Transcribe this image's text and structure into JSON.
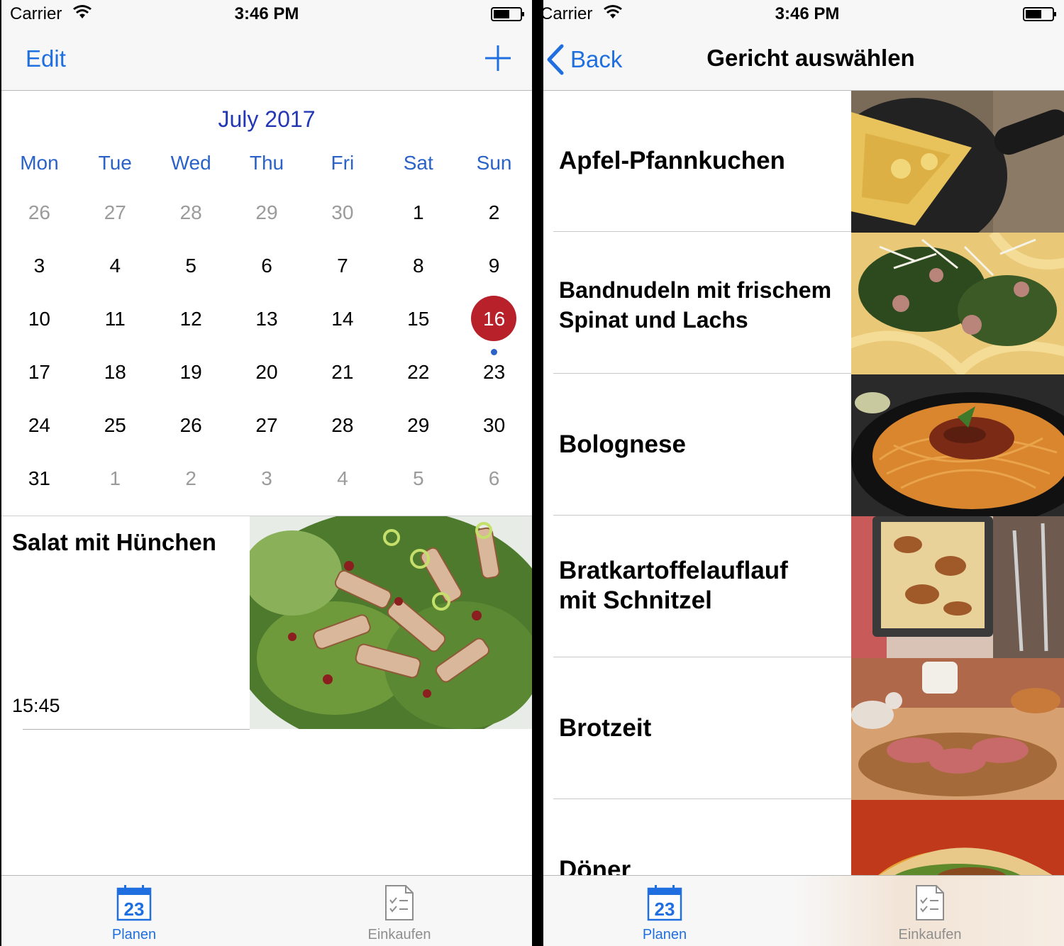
{
  "status_bar": {
    "carrier": "Carrier",
    "time": "3:46 PM"
  },
  "left": {
    "nav": {
      "edit_label": "Edit"
    },
    "calendar": {
      "month_title": "July 2017",
      "weekdays": [
        "Mon",
        "Tue",
        "Wed",
        "Thu",
        "Fri",
        "Sat",
        "Sun"
      ],
      "weeks": [
        [
          {
            "d": "26",
            "other": true
          },
          {
            "d": "27",
            "other": true
          },
          {
            "d": "28",
            "other": true
          },
          {
            "d": "29",
            "other": true
          },
          {
            "d": "30",
            "other": true
          },
          {
            "d": "1"
          },
          {
            "d": "2"
          }
        ],
        [
          {
            "d": "3"
          },
          {
            "d": "4"
          },
          {
            "d": "5"
          },
          {
            "d": "6"
          },
          {
            "d": "7"
          },
          {
            "d": "8"
          },
          {
            "d": "9"
          }
        ],
        [
          {
            "d": "10"
          },
          {
            "d": "11"
          },
          {
            "d": "12"
          },
          {
            "d": "13"
          },
          {
            "d": "14"
          },
          {
            "d": "15"
          },
          {
            "d": "16",
            "today": true,
            "event": true
          }
        ],
        [
          {
            "d": "17"
          },
          {
            "d": "18"
          },
          {
            "d": "19"
          },
          {
            "d": "20"
          },
          {
            "d": "21"
          },
          {
            "d": "22"
          },
          {
            "d": "23"
          }
        ],
        [
          {
            "d": "24"
          },
          {
            "d": "25"
          },
          {
            "d": "26"
          },
          {
            "d": "27"
          },
          {
            "d": "28"
          },
          {
            "d": "29"
          },
          {
            "d": "30"
          }
        ],
        [
          {
            "d": "31"
          },
          {
            "d": "1",
            "other": true
          },
          {
            "d": "2",
            "other": true
          },
          {
            "d": "3",
            "other": true
          },
          {
            "d": "4",
            "other": true
          },
          {
            "d": "5",
            "other": true
          },
          {
            "d": "6",
            "other": true
          }
        ]
      ],
      "today_color": "#b8202a",
      "accent_color": "#2437b5"
    },
    "planned_meal": {
      "name": "Salat mit Hünchen",
      "time": "15:45"
    }
  },
  "right": {
    "nav": {
      "back_label": "Back",
      "title": "Gericht auswählen"
    },
    "recipes": [
      {
        "name_lines": [
          "Apfel-Pfannkuchen"
        ]
      },
      {
        "name_lines": [
          "Bandnudeln mit frischem",
          "Spinat und Lachs"
        ]
      },
      {
        "name_lines": [
          "Bolognese"
        ]
      },
      {
        "name_lines": [
          "Bratkartoffelauflauf",
          "mit Schnitzel"
        ]
      },
      {
        "name_lines": [
          "Brotzeit"
        ]
      },
      {
        "name_lines": [
          "Döner"
        ]
      }
    ]
  },
  "tab_bar": {
    "tabs": [
      {
        "label": "Planen",
        "icon": "calendar-icon",
        "icon_text": "23",
        "active": true
      },
      {
        "label": "Einkaufen",
        "icon": "checklist-icon",
        "active": false
      }
    ],
    "active_color": "#1f6fe0"
  }
}
